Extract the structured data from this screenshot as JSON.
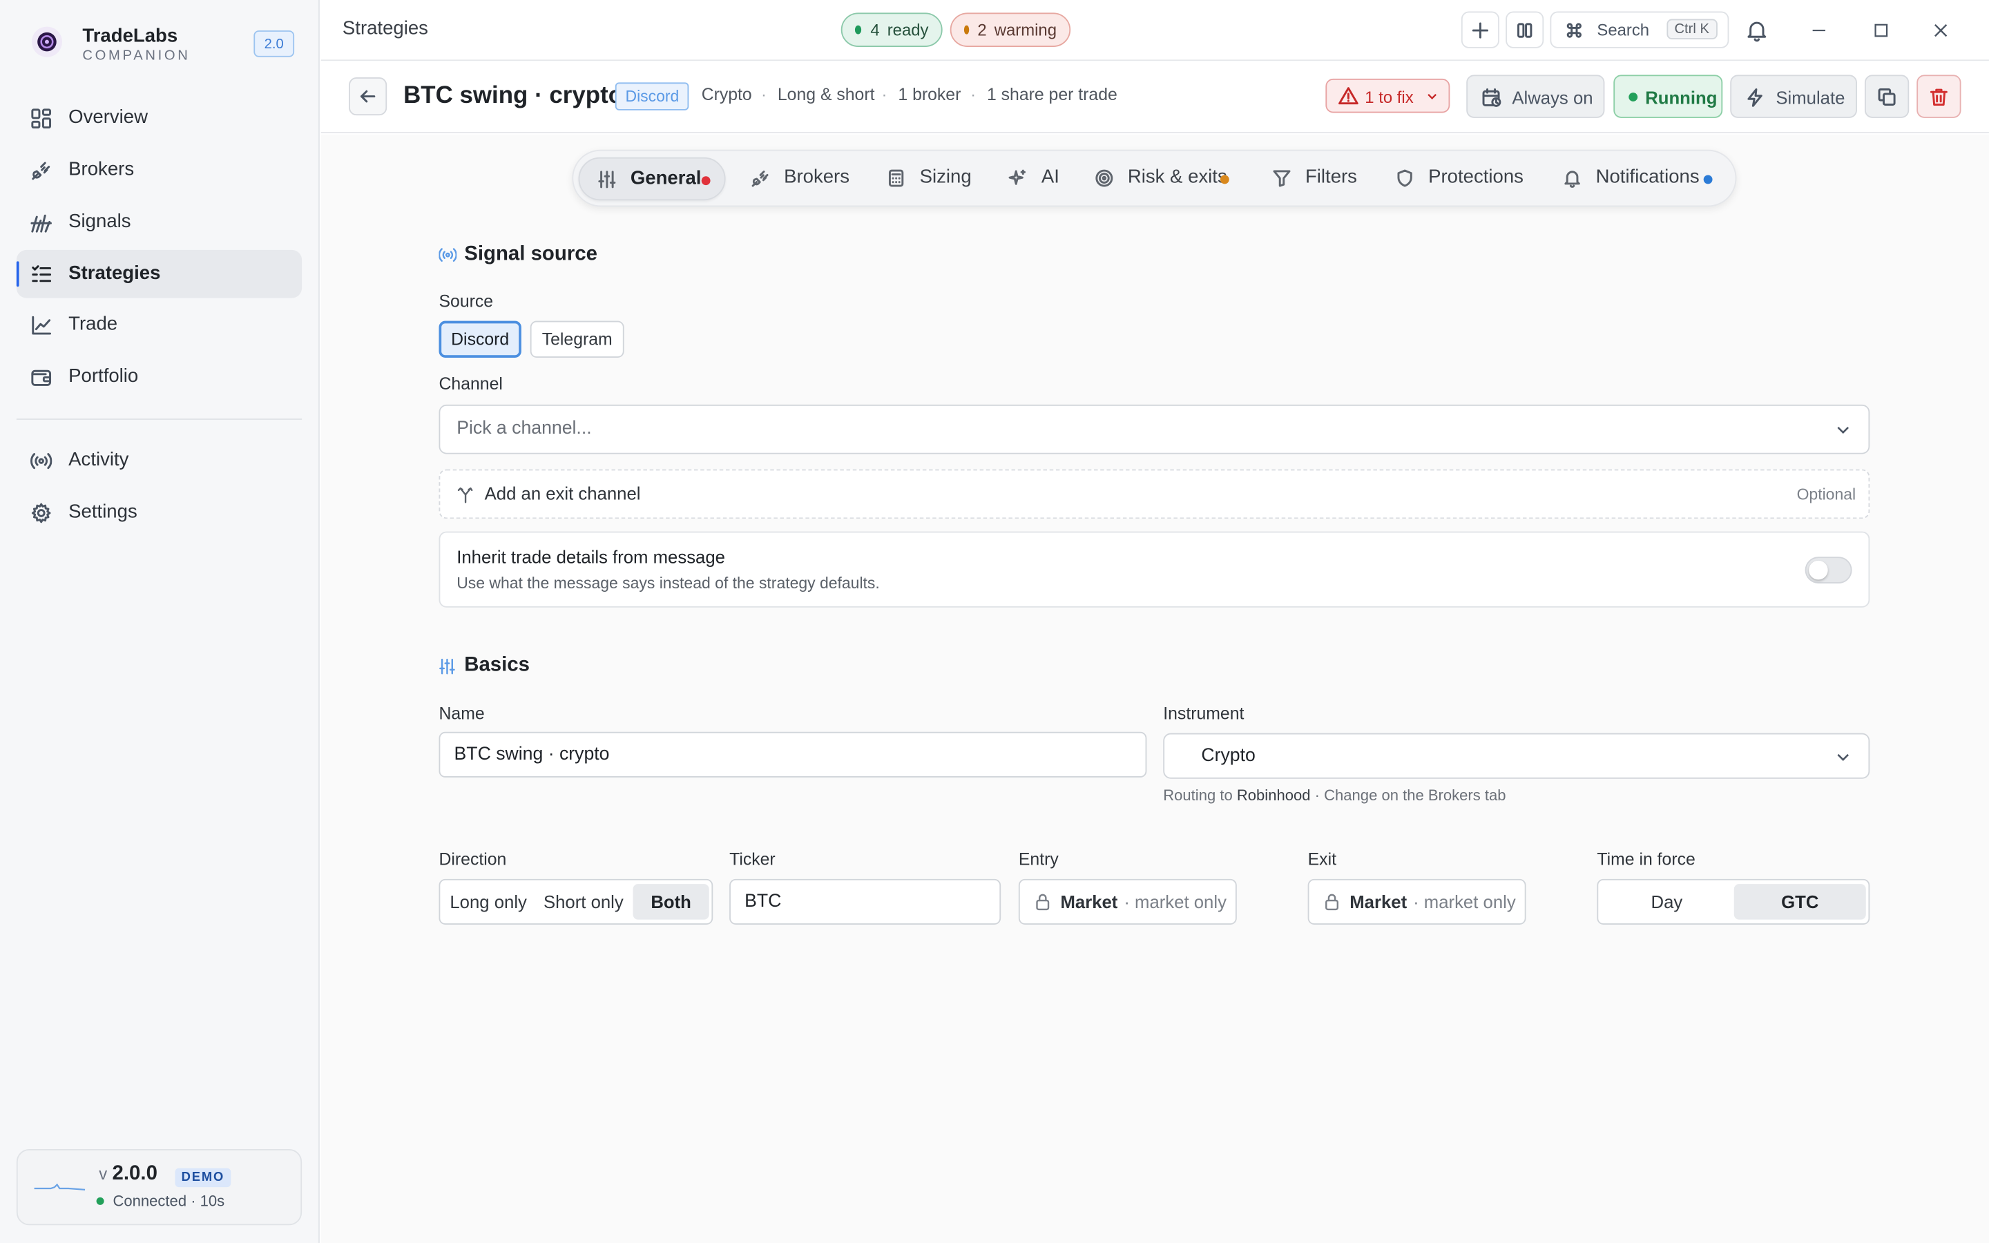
{
  "app": {
    "name": "TradeLabs",
    "subtitle": "COMPANION",
    "version_badge": "2.0"
  },
  "sidebar": {
    "items": [
      {
        "label": "Overview",
        "icon": "grid-icon"
      },
      {
        "label": "Brokers",
        "icon": "plug-icon"
      },
      {
        "label": "Signals",
        "icon": "signal-icon"
      },
      {
        "label": "Strategies",
        "icon": "list-icon",
        "active": true
      },
      {
        "label": "Trade",
        "icon": "chart-line-icon"
      },
      {
        "label": "Portfolio",
        "icon": "wallet-icon"
      },
      {
        "label": "Activity",
        "icon": "broadcast-icon"
      },
      {
        "label": "Settings",
        "icon": "gear-icon"
      }
    ],
    "version_card": {
      "prefix": "v",
      "version": "2.0.0",
      "badge": "DEMO",
      "status": "Connected · 10s"
    }
  },
  "titlebar": {
    "title": "Strategies",
    "ready_count": "4",
    "ready_label": "ready",
    "warming_count": "2",
    "warming_label": "warming",
    "search_label": "Search",
    "search_shortcut": "Ctrl K"
  },
  "header": {
    "title": "BTC swing · crypto",
    "source_badge": "Discord",
    "meta": [
      "Crypto",
      "Long & short",
      "1 broker",
      "1 share per trade"
    ],
    "meta_sep": "·",
    "fix_label": "1 to fix",
    "always_label": "Always on",
    "running_label": "Running",
    "simulate_label": "Simulate"
  },
  "tabs": [
    {
      "label": "General",
      "dot": "#e0323b",
      "active": true
    },
    {
      "label": "Brokers"
    },
    {
      "label": "Sizing"
    },
    {
      "label": "AI"
    },
    {
      "label": "Risk & exits",
      "dot": "#d9881c"
    },
    {
      "label": "Filters"
    },
    {
      "label": "Protections"
    },
    {
      "label": "Notifications",
      "dot": "#2b7bd6"
    }
  ],
  "signal_source": {
    "title": "Signal source",
    "source_label": "Source",
    "source_options": [
      "Discord",
      "Telegram"
    ],
    "source_selected": "Discord",
    "channel_label": "Channel",
    "channel_placeholder": "Pick a channel...",
    "exit_channel_label": "Add an exit channel",
    "exit_channel_hint": "Optional",
    "inherit_title": "Inherit trade details from message",
    "inherit_desc": "Use what the message says instead of the strategy defaults.",
    "inherit_enabled": false
  },
  "basics": {
    "title": "Basics",
    "name_label": "Name",
    "name_value": "BTC swing · crypto",
    "instrument_label": "Instrument",
    "instrument_value": "Crypto",
    "routing_prefix": "Routing to",
    "routing_broker": "Robinhood",
    "routing_suffix": "· Change on the Brokers tab",
    "direction_label": "Direction",
    "direction_options": [
      "Long only",
      "Short only",
      "Both"
    ],
    "direction_selected": "Both",
    "ticker_label": "Ticker",
    "ticker_value": "BTC",
    "entry_label": "Entry",
    "entry_value": "Market",
    "entry_sub": "· market only",
    "exit_label": "Exit",
    "exit_value": "Market",
    "exit_sub": "· market only",
    "tif_label": "Time in force",
    "tif_options": [
      "Day",
      "GTC"
    ],
    "tif_selected": "GTC"
  },
  "colors": {
    "accent": "#2563eb",
    "running": "#22a05a",
    "danger": "#c62828"
  }
}
